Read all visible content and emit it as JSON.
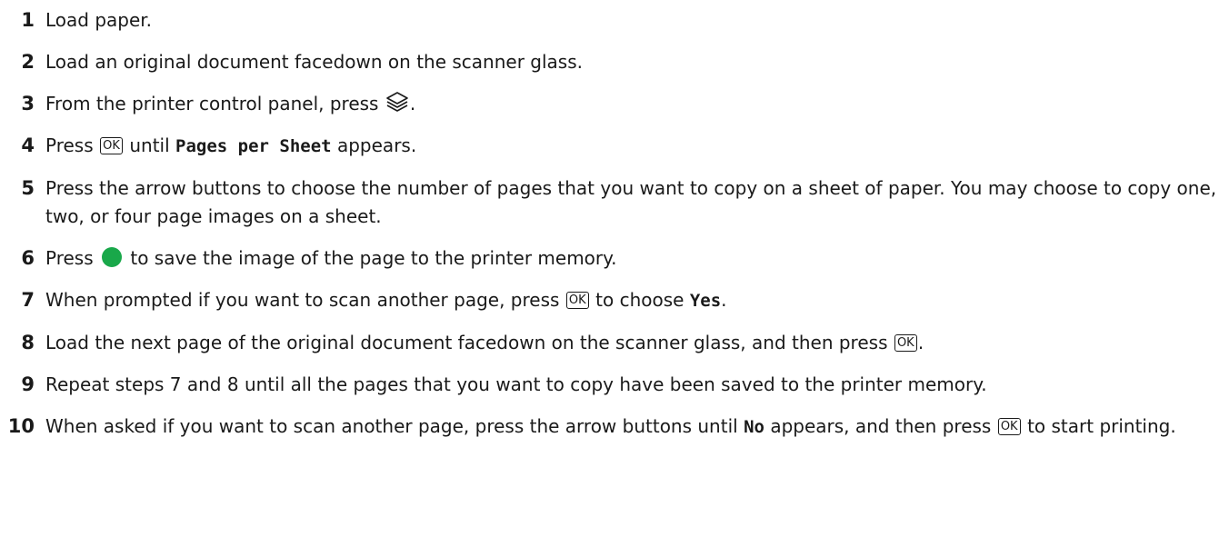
{
  "steps": [
    {
      "num": "1",
      "text": "Load paper."
    },
    {
      "num": "2",
      "text": "Load an original document facedown on the scanner glass."
    },
    {
      "num": "3",
      "pre": "From the printer control panel, press",
      "post": ".",
      "icon": "copy-mode-icon"
    },
    {
      "num": "4",
      "pre": "Press",
      "key": "OK",
      "mid": "until",
      "code": "Pages per Sheet",
      "post": "appears."
    },
    {
      "num": "5",
      "text": "Press the arrow buttons to choose the number of pages that you want to copy on a sheet of paper. You may choose to copy one, two, or four page images on a sheet."
    },
    {
      "num": "6",
      "pre": "Press",
      "icon": "start-button-icon",
      "post": "to save the image of the page to the printer memory.",
      "icon_color": "#19a84a"
    },
    {
      "num": "7",
      "pre": "When prompted if you want to scan another page, press",
      "key": "OK",
      "mid": "to choose",
      "code": "Yes",
      "post": "."
    },
    {
      "num": "8",
      "pre": "Load the next page of the original document facedown on the scanner glass, and then press",
      "key": "OK",
      "post": "."
    },
    {
      "num": "9",
      "text": "Repeat steps 7 and 8 until all the pages that you want to copy have been saved to the printer memory."
    },
    {
      "num": "10",
      "pre": "When asked if you want to scan another page, press the arrow buttons until",
      "code": "No",
      "mid": "appears, and then press",
      "key": "OK",
      "post": "to start printing."
    }
  ]
}
